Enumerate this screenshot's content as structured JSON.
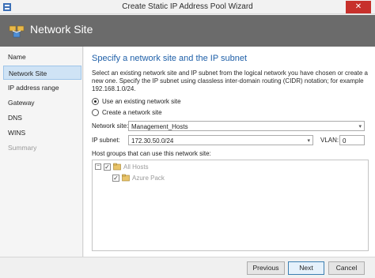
{
  "window": {
    "title": "Create Static IP Address Pool Wizard",
    "close_glyph": "✕"
  },
  "header": {
    "title": "Network Site",
    "icon": "network-site-icon"
  },
  "sidebar": {
    "items": [
      {
        "label": "Name",
        "state": "normal"
      },
      {
        "label": "Network Site",
        "state": "active"
      },
      {
        "label": "IP address range",
        "state": "normal"
      },
      {
        "label": "Gateway",
        "state": "normal"
      },
      {
        "label": "DNS",
        "state": "normal"
      },
      {
        "label": "WINS",
        "state": "normal"
      },
      {
        "label": "Summary",
        "state": "disabled"
      }
    ]
  },
  "main": {
    "heading": "Specify a network site and the IP subnet",
    "description": "Select an existing network site and IP subnet from the logical network you have chosen or create a new one. Specify the IP subnet using classless inter-domain routing (CIDR) notation; for example 192.168.1.0/24.",
    "options": {
      "use_existing": "Use an existing network site",
      "create_new": "Create a network site",
      "selected": "use_existing"
    },
    "network_site": {
      "label": "Network site:",
      "value": "Management_Hosts"
    },
    "ip_subnet": {
      "label": "IP subnet:",
      "value": "172.30.50.0/24"
    },
    "vlan": {
      "label": "VLAN:",
      "value": "0"
    },
    "host_groups": {
      "label": "Host groups that can use this network site:",
      "tree": [
        {
          "label": "All Hosts",
          "checked": true,
          "expanded": true
        },
        {
          "label": "Azure Pack",
          "checked": true
        }
      ],
      "expander_glyph": "−",
      "check_glyph": "✓"
    }
  },
  "footer": {
    "previous": "Previous",
    "next": "Next",
    "cancel": "Cancel"
  },
  "colors": {
    "header_bg": "#6b6b6b",
    "accent": "#1e5fa8",
    "close": "#c7312c",
    "active_nav": "#cfe3f5"
  },
  "dropdown_glyph": "▾"
}
